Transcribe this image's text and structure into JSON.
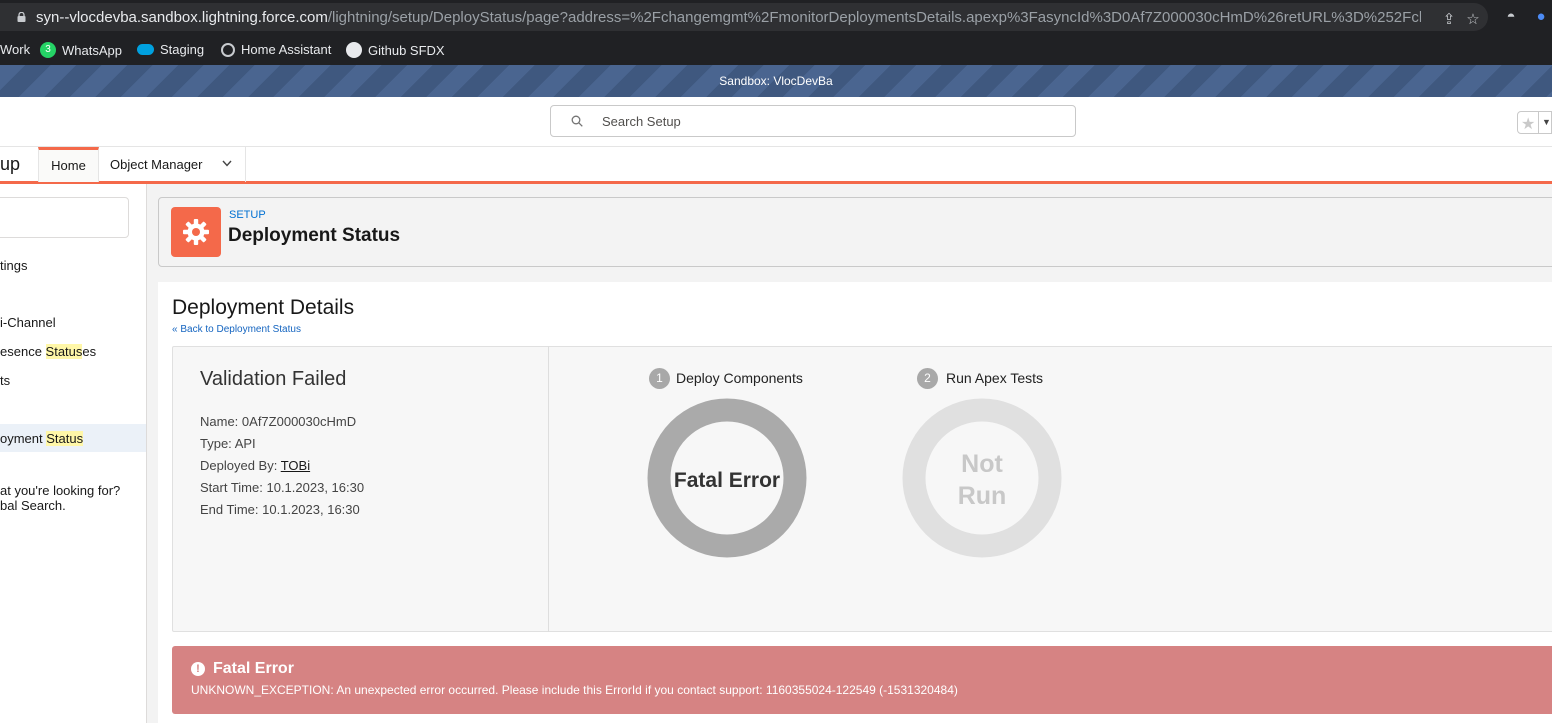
{
  "browser": {
    "url_host": "syn--vlocdevba.sandbox.lightning.force.com",
    "url_path": "/lightning/setup/DeployStatus/page?address=%2Fchangemgmt%2FmonitorDeploymentsDetails.apexp%3FasyncId%3D0Af7Z000030cHmD%26retURL%3D%252Fcha...",
    "bookmarks": [
      {
        "label": "Work",
        "icon": "folder-icon"
      },
      {
        "label": "WhatsApp",
        "icon": "whatsapp-icon",
        "badge": "3"
      },
      {
        "label": "Staging",
        "icon": "salesforce-cloud-icon"
      },
      {
        "label": "Home Assistant",
        "icon": "globe-icon"
      },
      {
        "label": "Github SFDX",
        "icon": "github-icon"
      }
    ],
    "colors": {
      "chrome_bg": "#202124",
      "url_pill": "#2f3033"
    }
  },
  "sandbox_banner": "Sandbox: VlocDevBa",
  "global_header": {
    "search_placeholder": "Search Setup"
  },
  "navbar": {
    "app_name": "up",
    "tabs": [
      {
        "label": "Home",
        "active": true
      },
      {
        "label": "Object Manager",
        "has_dropdown": true
      }
    ],
    "accent": "#f4694a"
  },
  "sidebar": {
    "items": [
      {
        "pre": "tings",
        "hl": "",
        "post": ""
      },
      {
        "pre": "i-Channel",
        "hl": "",
        "post": ""
      },
      {
        "pre": "esence ",
        "hl": "Status",
        "post": "es"
      },
      {
        "pre": "ts",
        "hl": "",
        "post": ""
      },
      {
        "pre": "oyment ",
        "hl": "Status",
        "post": "",
        "selected": true
      }
    ],
    "help_line1": "at you're looking for?",
    "help_line2": "bal Search."
  },
  "page_header": {
    "kicker": "SETUP",
    "title": "Deployment Status",
    "icon": "gear-icon"
  },
  "details": {
    "title": "Deployment Details",
    "back_link": "« Back to Deployment Status",
    "status_title": "Validation Failed",
    "name_label": "Name:",
    "name_value": "0Af7Z000030cHmD",
    "type_label": "Type:",
    "type_value": "API",
    "deployed_by_label": "Deployed By:",
    "deployed_by_value": "TOBi",
    "start_label": "Start Time:",
    "start_value": "10.1.2023, 16:30",
    "end_label": "End Time:",
    "end_value": "10.1.2023, 16:30"
  },
  "steps": [
    {
      "number": "1",
      "label": "Deploy Components",
      "status_line1": "Fatal Error",
      "status_line2": "",
      "ring_color": "#aaaaaa",
      "text_color": "#333333"
    },
    {
      "number": "2",
      "label": "Run Apex Tests",
      "status_line1": "Not",
      "status_line2": "Run",
      "ring_color": "#e0e0e0",
      "text_color": "#c8c8c8"
    }
  ],
  "error": {
    "title": "Fatal Error",
    "message": "UNKNOWN_EXCEPTION: An unexpected error occurred. Please include this ErrorId if you contact support: 1160355024-122549 (-1531320484)",
    "bg_color": "#d68383"
  }
}
